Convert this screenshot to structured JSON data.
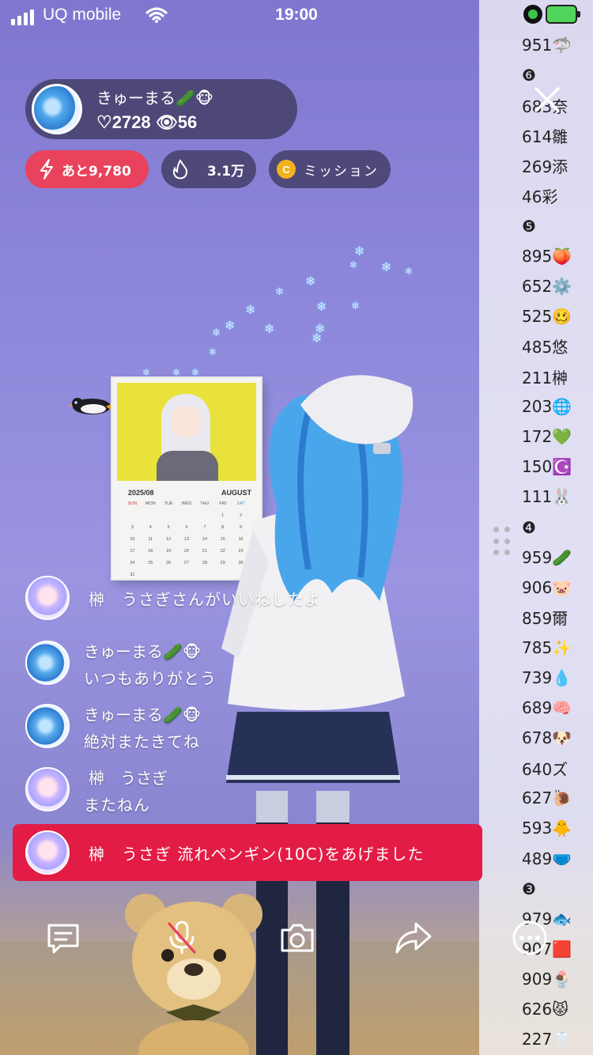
{
  "status_bar": {
    "carrier": "UQ mobile",
    "time": "19:00"
  },
  "host": {
    "name": "きゅーまる🥒🐵",
    "stats": "♡2728 👁56"
  },
  "pills": {
    "goal": "あと9,780",
    "fire": "3.1万",
    "coin_letter": "C",
    "mission": "ミッション"
  },
  "calendar": {
    "month_label": "2025/08",
    "month_name": "AUGUST",
    "weekdays": [
      "SUN",
      "MON",
      "TUE",
      "WED",
      "THU",
      "FRI",
      "SAT"
    ]
  },
  "ranking": [
    "951🦈",
    "❻",
    "683奈",
    "614雛",
    "269添",
    "46彩",
    "❺",
    "895🍑",
    "652⚙️",
    "525🥴",
    "485悠",
    "211榊",
    "203🌐",
    "172💚",
    "150☪️",
    "111🐰",
    "❹",
    "959🥒",
    "906🐷",
    "859爾",
    "785✨",
    "739💧",
    "689🧠",
    "678🐶",
    "640ズ",
    "627🐌",
    "593🐥",
    "489🩲",
    "❸",
    "979🐟",
    "907🟥",
    "909🍨",
    "626😾",
    "227🦷"
  ],
  "comments": [
    {
      "type": "inline",
      "avatar": "usagi",
      "text": "榊　うさぎさんがいいねしたよ"
    },
    {
      "type": "two",
      "avatar": "kyu",
      "name": "きゅーまる🥒🐵",
      "text": "いつもありがとう"
    },
    {
      "type": "two",
      "avatar": "kyu",
      "name": "きゅーまる🥒🐵",
      "text": "絶対またきてね"
    },
    {
      "type": "two",
      "avatar": "usagi",
      "name": "榊　うさぎ",
      "text": "またねん"
    }
  ],
  "gift": {
    "text": "榊　うさぎ 流れペンギン(10C)をあげました"
  },
  "colors": {
    "goal_pill": "#e8425c",
    "gift_bar": "#e31c45",
    "coin": "#f1b21e",
    "panel": "#3c375a"
  },
  "toolbar": {
    "icons": [
      "comment-icon",
      "mic-muted-icon",
      "camera-icon",
      "share-icon",
      "more-icon"
    ]
  }
}
